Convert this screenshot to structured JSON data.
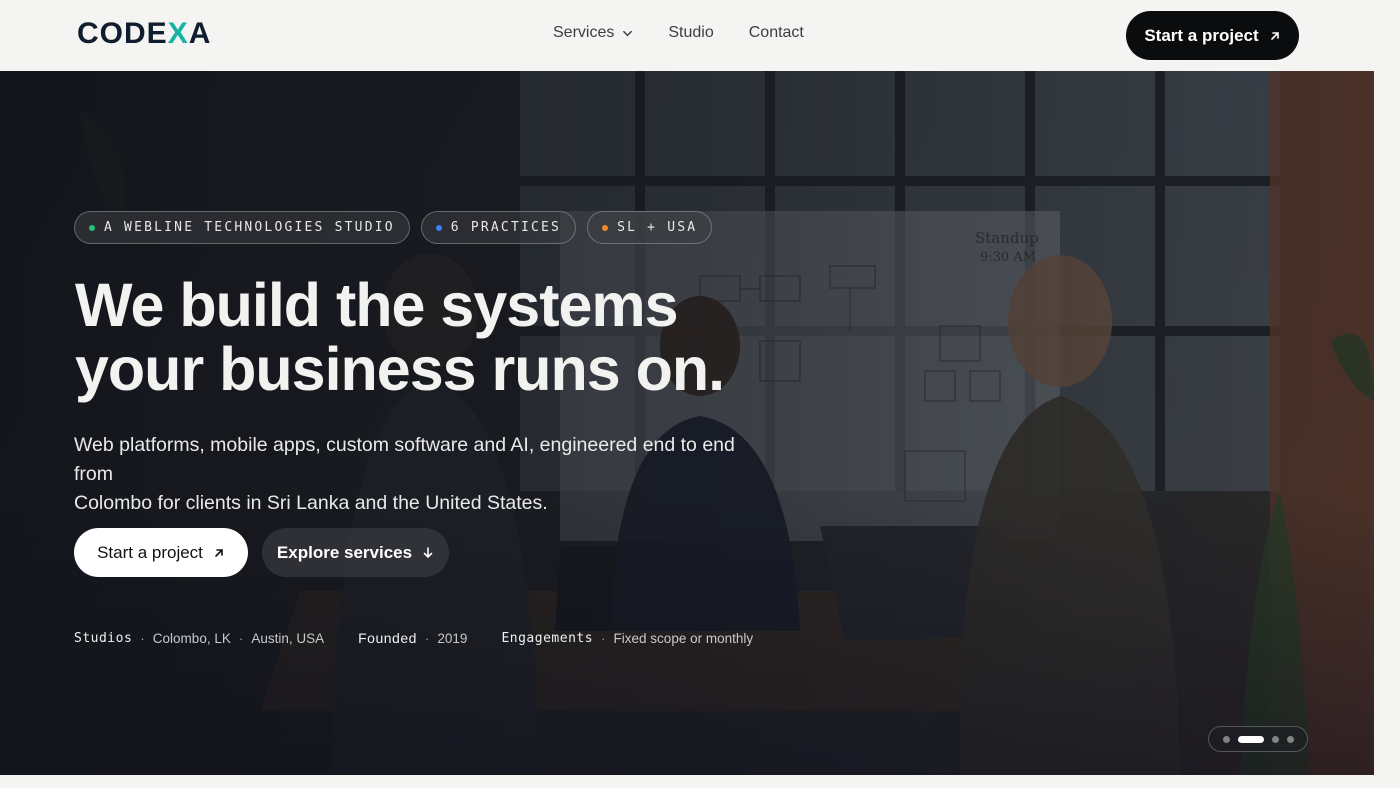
{
  "brand": {
    "logo_pre": "CODE",
    "logo_x": "X",
    "logo_post": "A",
    "accent": "#16b2a4"
  },
  "nav": {
    "items": [
      {
        "label": "Services",
        "has_dropdown": true,
        "icon": "chevron-down-icon"
      },
      {
        "label": "Studio"
      },
      {
        "label": "Contact"
      }
    ]
  },
  "header": {
    "cta_label": "Start a project",
    "cta_icon": "arrow-up-right-icon"
  },
  "hero": {
    "pills": [
      {
        "label": "A WEBLINE TECHNOLOGIES STUDIO",
        "dot_color": "#22c07a"
      },
      {
        "label": "6 PRACTICES",
        "dot_color": "#3b82f6"
      },
      {
        "label": "SL + USA",
        "dot_color": "#f08a24"
      }
    ],
    "headline_line1": "We build the systems",
    "headline_line2": "your business runs on.",
    "subtitle_line1": "Web platforms, mobile apps, custom software and AI, engineered end to end from",
    "subtitle_line2": "Colombo for clients in Sri Lanka and the United States.",
    "primary_cta": "Start a project",
    "secondary_cta": "Explore services",
    "meta": {
      "studios_label": "Studios",
      "studio_1": "Colombo, LK",
      "studio_2": "Austin, USA",
      "founded_label": "Founded",
      "founded_value": "2019",
      "engagements_label": "Engagements",
      "engagements_value": "Fixed scope or monthly",
      "separator": "·"
    },
    "carousel": {
      "slides": 4,
      "active_index": 1
    }
  }
}
